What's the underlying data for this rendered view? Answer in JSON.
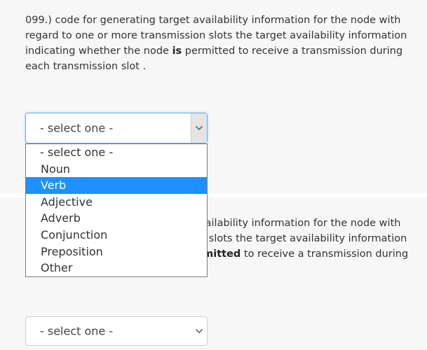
{
  "questions": [
    {
      "text_before": "099.) code for generating target availability information for the node with regard to one or more transmission slots the target availability information indicating whether the node ",
      "bold": "is",
      "text_after": " permitted to receive a transmission during each transmission slot .",
      "select_value": "- select one -"
    },
    {
      "text_before": "100.) code for generating target availability information for the node with regard to one or more transmission slots the target availability information indicating whether the node is ",
      "bold": "permitted",
      "text_after": " to receive a transmission during each transmission slot .",
      "select_value": "- select one -"
    }
  ],
  "dropdown": {
    "options": [
      "- select one -",
      "Noun",
      "Verb",
      "Adjective",
      "Adverb",
      "Conjunction",
      "Preposition",
      "Other"
    ],
    "highlighted": "Verb"
  },
  "icons": {
    "select_arrow": "chevron-down-icon"
  },
  "colors": {
    "highlight": "#1e90ff",
    "focus_border": "#66afe9",
    "panel_background": "#f7f7f7"
  }
}
